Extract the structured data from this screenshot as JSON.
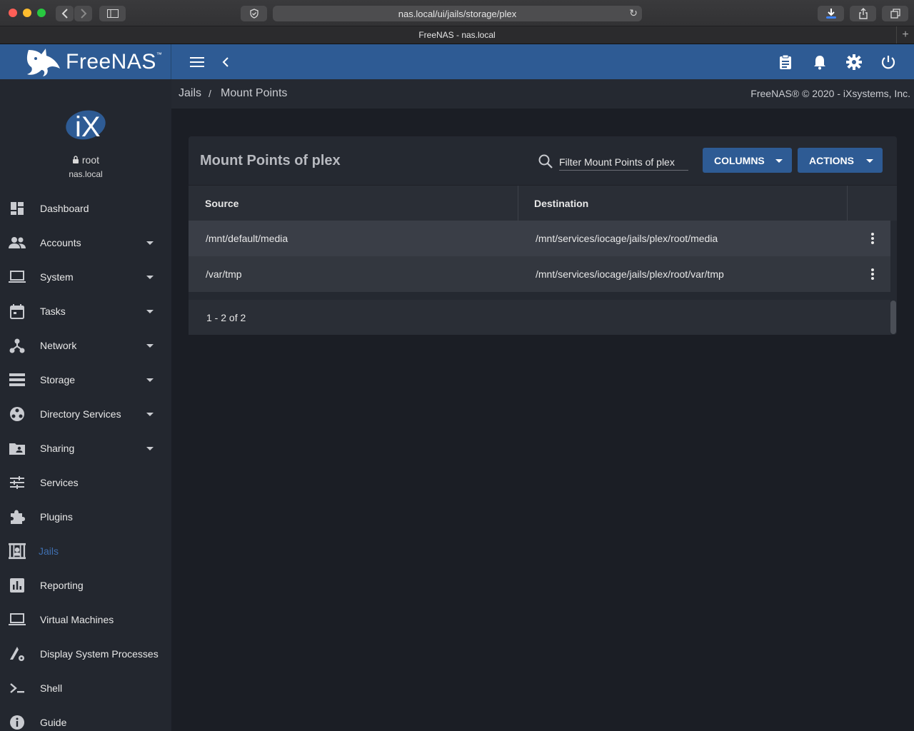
{
  "browser": {
    "url": "nas.local/ui/jails/storage/plex",
    "tab_title": "FreeNAS - nas.local"
  },
  "app": {
    "brand": "FreeNAS",
    "tm": "™"
  },
  "user": {
    "name": "root",
    "host": "nas.local"
  },
  "sidebar": {
    "items": [
      {
        "label": "Dashboard",
        "icon": "dashboard-icon"
      },
      {
        "label": "Accounts",
        "icon": "accounts-icon"
      },
      {
        "label": "System",
        "icon": "laptop-icon"
      },
      {
        "label": "Tasks",
        "icon": "calendar-icon"
      },
      {
        "label": "Network",
        "icon": "network-icon"
      },
      {
        "label": "Storage",
        "icon": "storage-icon"
      },
      {
        "label": "Directory Services",
        "icon": "directory-icon"
      },
      {
        "label": "Sharing",
        "icon": "folder-shared-icon"
      },
      {
        "label": "Services",
        "icon": "tune-icon"
      },
      {
        "label": "Plugins",
        "icon": "puzzle-icon"
      },
      {
        "label": "Jails",
        "icon": "jail-icon"
      },
      {
        "label": "Reporting",
        "icon": "chart-icon"
      },
      {
        "label": "Virtual Machines",
        "icon": "laptop-icon"
      },
      {
        "label": "Display System Processes",
        "icon": "processes-icon"
      },
      {
        "label": "Shell",
        "icon": "terminal-icon"
      },
      {
        "label": "Guide",
        "icon": "info-icon"
      }
    ]
  },
  "breadcrumb": {
    "parent": "Jails",
    "separator": "/",
    "current": "Mount Points"
  },
  "copyright": "FreeNAS® © 2020 - iXsystems, Inc.",
  "card": {
    "title": "Mount Points of plex",
    "filter_placeholder": "Filter Mount Points of plex",
    "columns_label": "COLUMNS",
    "actions_label": "ACTIONS",
    "headers": {
      "source": "Source",
      "destination": "Destination"
    },
    "rows": [
      {
        "source": "/mnt/default/media",
        "destination": "/mnt/services/iocage/jails/plex/root/media"
      },
      {
        "source": "/var/tmp",
        "destination": "/mnt/services/iocage/jails/plex/root/var/tmp"
      }
    ],
    "pagination": "1 - 2 of 2"
  },
  "colors": {
    "accent": "#2e5b94",
    "active_nav": "#3f6fb0",
    "sidebar_bg": "#23272f",
    "page_bg": "#1b1e25"
  }
}
